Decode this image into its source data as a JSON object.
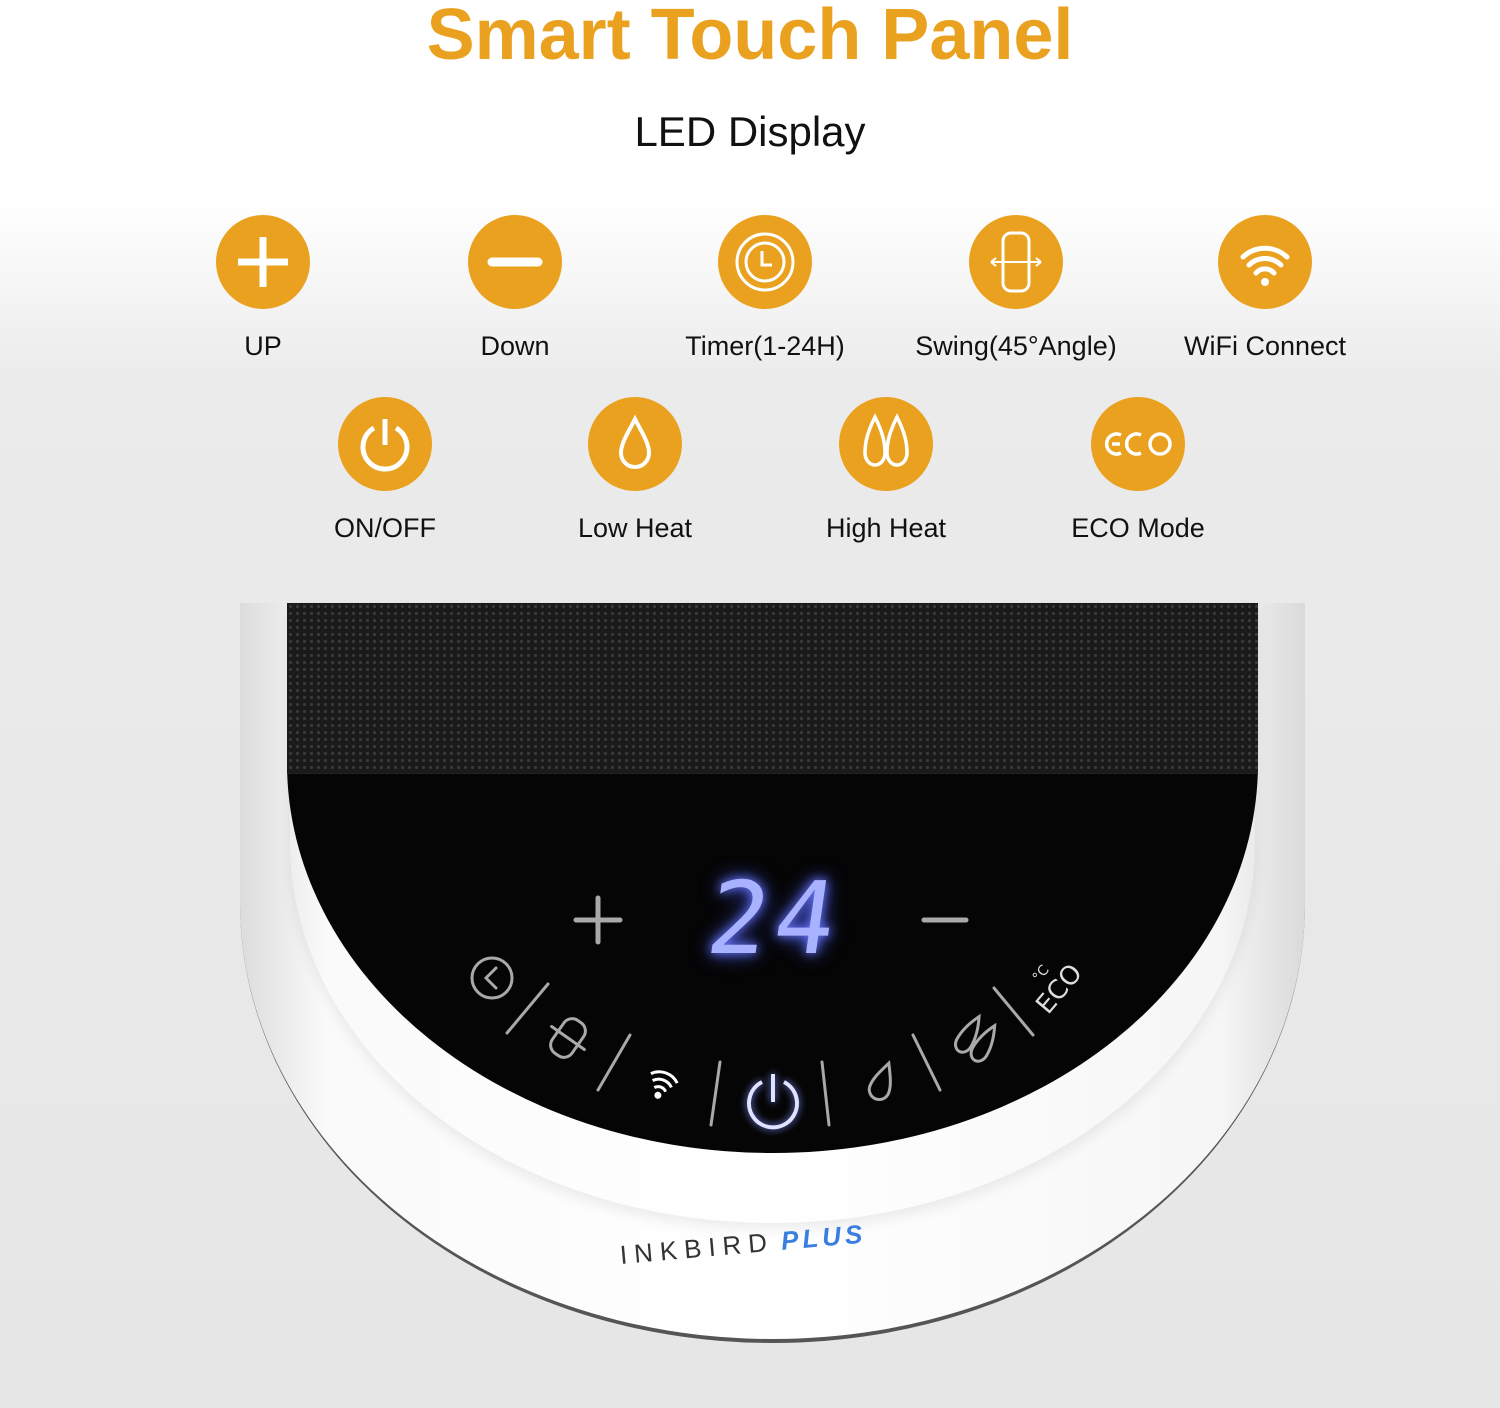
{
  "header": {
    "title": "Smart Touch Panel",
    "subtitle": "LED Display"
  },
  "accent_color": "#E9A11F",
  "features": [
    {
      "label": "UP",
      "icon": "plus-icon"
    },
    {
      "label": "Down",
      "icon": "minus-icon"
    },
    {
      "label": "Timer(1-24H)",
      "icon": "timer-clock-icon"
    },
    {
      "label": "Swing(45°Angle)",
      "icon": "swing-icon"
    },
    {
      "label": "WiFi Connect",
      "icon": "wifi-icon"
    },
    {
      "label": "ON/OFF",
      "icon": "power-icon"
    },
    {
      "label": "Low Heat",
      "icon": "single-flame-icon"
    },
    {
      "label": "High Heat",
      "icon": "double-flame-icon"
    },
    {
      "label": "ECO Mode",
      "icon": "eco-icon"
    }
  ],
  "device": {
    "display_value": "24",
    "display_color": "#a9b2ff",
    "eco_label": "ECO",
    "unit_label": "°C",
    "brand": {
      "name": "INKBIRD",
      "suffix": "PLUS"
    }
  }
}
